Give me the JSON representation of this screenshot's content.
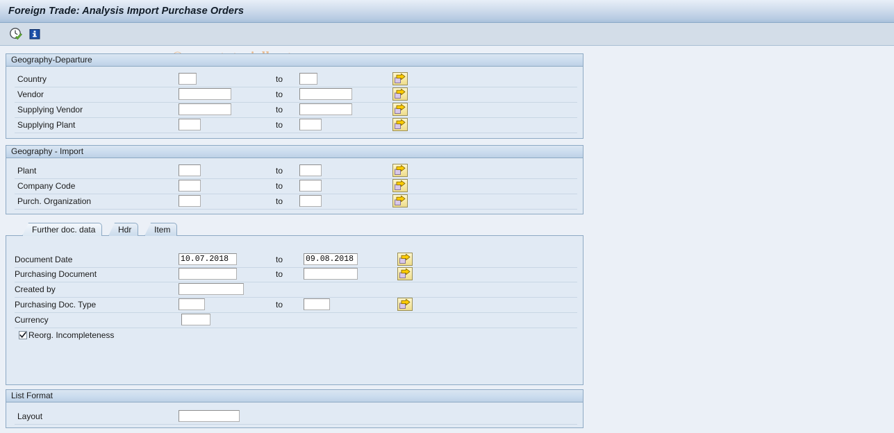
{
  "window": {
    "title": "Foreign Trade: Analysis Import Purchase Orders"
  },
  "watermark": {
    "text": "© www.tutorialkart.com"
  },
  "toolbar": {
    "buttons": [
      {
        "name": "execute-button",
        "icon": "clock-check-icon",
        "tooltip": "Execute"
      },
      {
        "name": "info-button",
        "icon": "information-icon",
        "tooltip": "Information"
      }
    ]
  },
  "groups": {
    "geography_departure": {
      "title": "Geography-Departure",
      "rows": [
        {
          "label": "Country",
          "from_value": "",
          "to_label": "to",
          "to_value": "",
          "has_multi": true
        },
        {
          "label": "Vendor",
          "from_value": "",
          "to_label": "to",
          "to_value": "",
          "has_multi": true
        },
        {
          "label": "Supplying Vendor",
          "from_value": "",
          "to_label": "to",
          "to_value": "",
          "has_multi": true
        },
        {
          "label": "Supplying Plant",
          "from_value": "",
          "to_label": "to",
          "to_value": "",
          "has_multi": true
        }
      ]
    },
    "geography_import": {
      "title": "Geography - Import",
      "rows": [
        {
          "label": "Plant",
          "from_value": "",
          "to_label": "to",
          "to_value": "",
          "has_multi": true
        },
        {
          "label": "Company Code",
          "from_value": "",
          "to_label": "to",
          "to_value": "",
          "has_multi": true
        },
        {
          "label": "Purch. Organization",
          "from_value": "",
          "to_label": "to",
          "to_value": "",
          "has_multi": true
        }
      ]
    },
    "list_format": {
      "title": "List Format",
      "rows": [
        {
          "label": "Layout",
          "from_value": "",
          "to_label": "",
          "to_value": "",
          "has_multi": false
        }
      ]
    }
  },
  "tabs": [
    {
      "label": "Further doc. data",
      "active": true
    },
    {
      "label": "Hdr",
      "active": false
    },
    {
      "label": "Item",
      "active": false
    }
  ],
  "doc_tab": {
    "rows": [
      {
        "label": "Document Date",
        "from_value": "10.07.2018",
        "to_label": "to",
        "to_value": "09.08.2018",
        "has_multi": true
      },
      {
        "label": "Purchasing Document",
        "from_value": "",
        "to_label": "to",
        "to_value": "",
        "has_multi": true
      },
      {
        "label": "Created by",
        "from_value": "",
        "to_label": "",
        "to_value": "",
        "has_multi": false
      },
      {
        "label": "Purchasing Doc. Type",
        "from_value": "",
        "to_label": "to",
        "to_value": "",
        "has_multi": true
      },
      {
        "label": "Currency",
        "from_value": "",
        "to_label": "",
        "to_value": "",
        "has_multi": false
      }
    ],
    "checkbox": {
      "label": "Reorg. Incompleteness",
      "checked": true
    }
  },
  "colors": {
    "page_background": "#ebf0f7",
    "groupbox_background": "#e1eaf4",
    "groupbox_border": "#8da9c4",
    "titlebar_gradient_top": "#e8eff8",
    "titlebar_gradient_bottom": "#a9c0da",
    "toolbar_background": "#d3dde8",
    "multiselect_yellow": "#f6e9a8",
    "multiselect_arrow": "#ffcc00",
    "watermark_orange": "#e8b584"
  }
}
